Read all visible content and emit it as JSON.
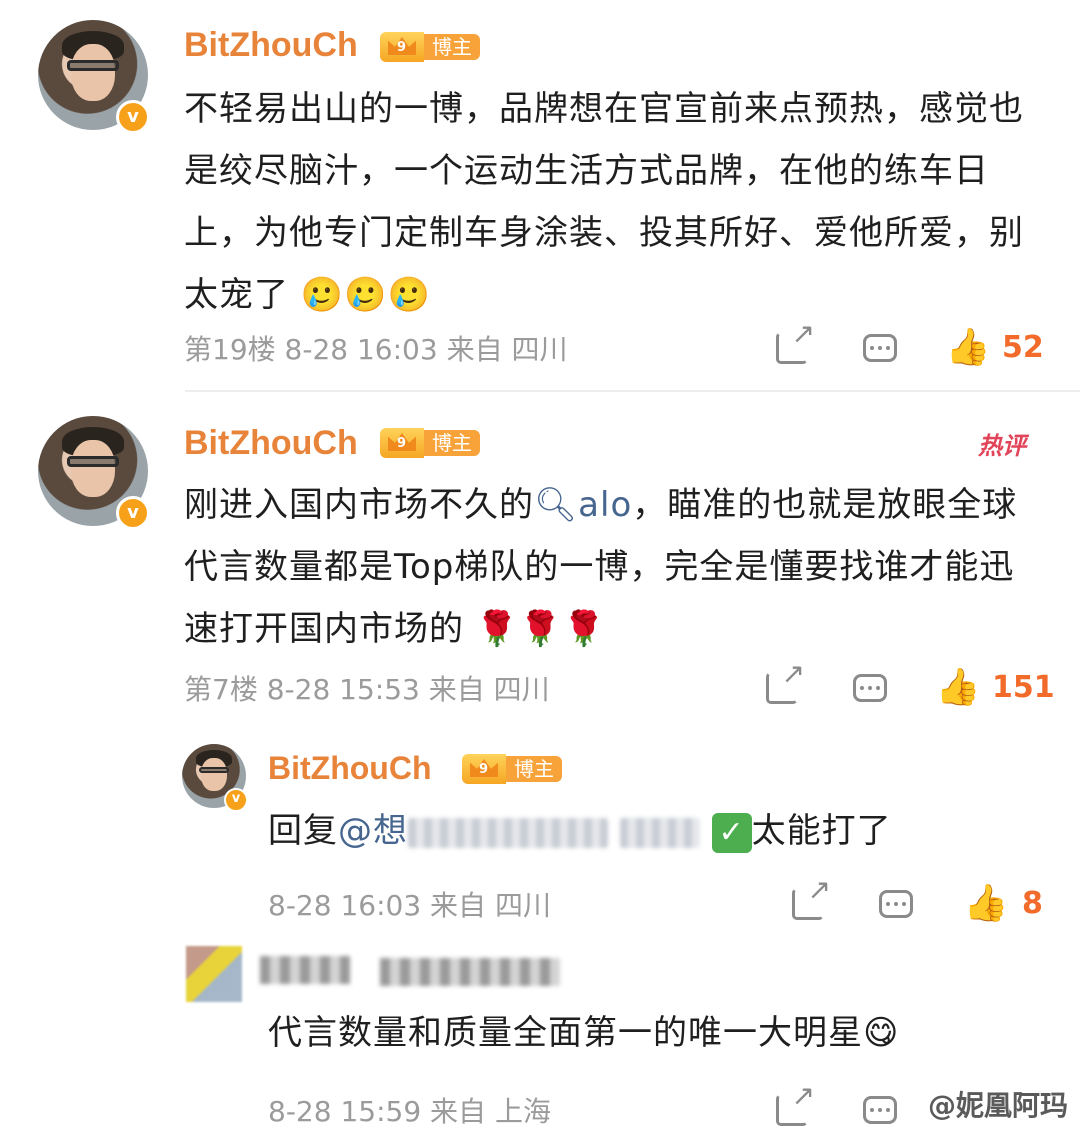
{
  "comments": [
    {
      "user": "BitZhouCh",
      "badge": "博主",
      "text": "不轻易出山的一博，品牌想在官宣前来点预热，感觉也是绞尽脑汁，一个运动生活方式品牌，在他的练车日上，为他专门定制车身涂装、投其所好、爱他所爱，别太宠了",
      "emoji": "🥲🥲🥲",
      "meta": "第19楼 8-28 16:03 来自 四川",
      "likes": "52"
    },
    {
      "user": "BitZhouCh",
      "badge": "博主",
      "hot": "热评",
      "text_pre": "刚进入国内市场不久的",
      "link": "alo",
      "text_post": "，瞄准的也就是放眼全球代言数量都是Top梯队的一博，完全是懂要找谁才能迅速打开国内市场的",
      "emoji": "🌹🌹🌹",
      "meta": "第7楼 8-28 15:53 来自 四川",
      "likes": "151"
    }
  ],
  "replies": [
    {
      "user": "BitZhouCh",
      "badge": "博主",
      "reply_prefix": "回复",
      "mention": "@想",
      "text_post": "太能打了",
      "meta": "8-28 16:03 来自 四川",
      "likes": "8"
    },
    {
      "text": "代言数量和质量全面第一的唯一大明星",
      "emoji": "😋",
      "meta": "8-28 15:59 来自 上海"
    }
  ],
  "watermark": "@妮凰阿玛",
  "icons": {
    "share": "share-icon",
    "comment": "comment-icon",
    "like": "thumbs-up-icon",
    "verified": "verified-v-icon",
    "search": "search-icon"
  },
  "colors": {
    "username": "#e8833a",
    "like": "#f26b2b",
    "link": "#46658f",
    "hot": "#e2455a",
    "meta": "#9b9b9b"
  }
}
